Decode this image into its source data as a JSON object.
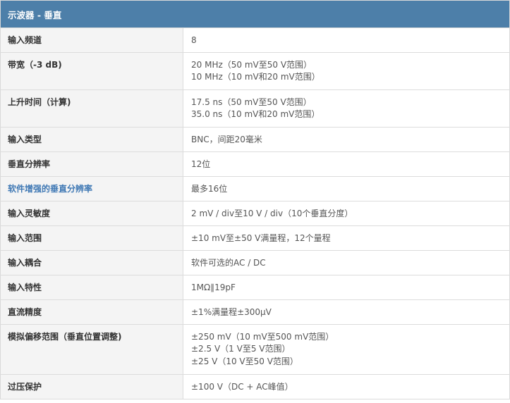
{
  "title": "示波器 - 垂直",
  "rows": [
    {
      "label": "输入频道",
      "values": [
        "8"
      ],
      "h": 35
    },
    {
      "label": "带宽（-3 dB)",
      "values": [
        "20 MHz（50 mV至50 V范围）",
        "10 MHz（10 mV和20 mV范围）"
      ],
      "h": 53
    },
    {
      "label": "上升时间（计算)",
      "values": [
        "17.5 ns（50 mV至50 V范围）",
        "35.0 ns（10 mV和20 mV范围）"
      ],
      "h": 53
    },
    {
      "label": "输入类型",
      "values": [
        "BNC，间距20毫米"
      ],
      "h": 35
    },
    {
      "label": "垂直分辨率",
      "values": [
        "12位"
      ],
      "h": 35
    },
    {
      "label": "软件增强的垂直分辨率",
      "values": [
        "最多16位"
      ],
      "h": 35,
      "link": true
    },
    {
      "label": "输入灵敏度",
      "values": [
        "2 mV / div至10 V / div（10个垂直分度）"
      ],
      "h": 35
    },
    {
      "label": "输入范围",
      "values": [
        "±10 mV至±50 V满量程，12个量程"
      ],
      "h": 35
    },
    {
      "label": "输入耦合",
      "values": [
        "软件可选的AC / DC"
      ],
      "h": 35
    },
    {
      "label": "输入特性",
      "values": [
        "1MΩ∥19pF"
      ],
      "h": 35
    },
    {
      "label": "直流精度",
      "values": [
        "±1%满量程±300μV"
      ],
      "h": 35
    },
    {
      "label": "模拟偏移范围（垂直位置调整)",
      "values": [
        "±250 mV（10 mV至500 mV范围）",
        "±2.5 V（1 V至5 V范围）",
        "±25 V（10 V至50 V范围）"
      ],
      "h": 71
    },
    {
      "label": "过压保护",
      "values": [
        "±100 V（DC + AC峰值）"
      ],
      "h": 35
    }
  ]
}
